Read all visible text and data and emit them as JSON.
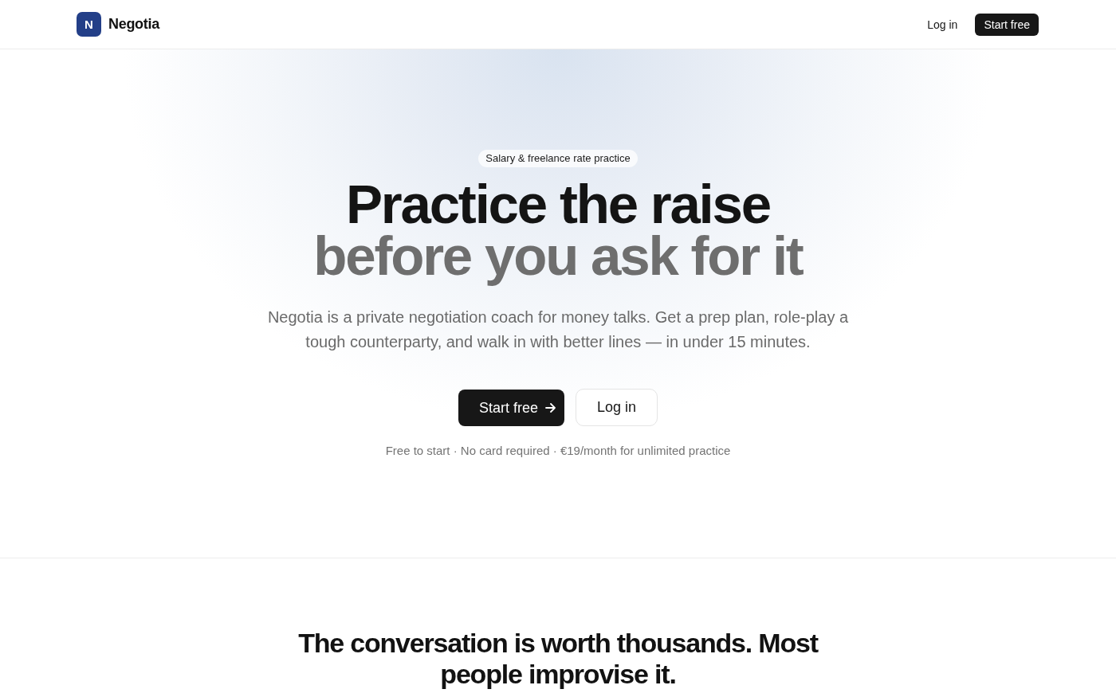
{
  "header": {
    "logo_letter": "N",
    "brand": "Negotia",
    "nav": [
      {
        "label": "Log in",
        "kind": "link"
      },
      {
        "label": "Start free",
        "kind": "primary"
      }
    ]
  },
  "hero": {
    "badge": "Salary & freelance rate practice",
    "headline": [
      {
        "text": "Practice the raise",
        "muted": false
      },
      {
        "text": "before you ask for it",
        "muted": true
      }
    ],
    "subtitle": "Negotia is a private negotiation coach for money talks. Get a prep plan, role-play a tough counterparty, and walk in with better lines — in under 15 minutes.",
    "buttons": [
      {
        "label": "Start free",
        "kind": "primary"
      },
      {
        "label": "Log in",
        "kind": "secondary"
      }
    ],
    "note": "Free to start · No card required · €19/month for unlimited practice"
  },
  "section": {
    "heading": "The conversation is worth thousands. Most people improvise it."
  }
}
